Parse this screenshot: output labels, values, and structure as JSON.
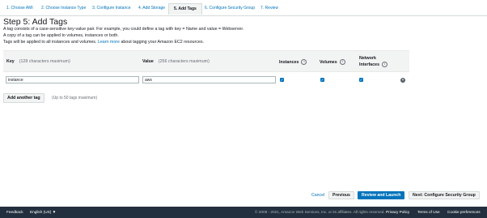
{
  "wizard": {
    "tabs": [
      {
        "label": "1. Choose AMI"
      },
      {
        "label": "2. Choose Instance Type"
      },
      {
        "label": "3. Configure Instance"
      },
      {
        "label": "4. Add Storage"
      },
      {
        "label": "5. Add Tags"
      },
      {
        "label": "6. Configure Security Group"
      },
      {
        "label": "7. Review"
      }
    ],
    "active_tab": "5. Add Tags"
  },
  "page": {
    "title": "Step 5: Add Tags",
    "desc_line1": "A tag consists of a case-sensitive key-value pair. For example, you could define a tag with key = Name and value = Webserver.",
    "desc_line2": "A copy of a tag can be applied to volumes, instances or both.",
    "desc_line3_prefix": "Tags will be applied to all instances and volumes.",
    "learn_more": "Learn more",
    "desc_line3_suffix": "about tagging your Amazon EC2 resources."
  },
  "table": {
    "headers": {
      "key": "Key",
      "key_hint": "(128 characters maximum)",
      "value": "Value",
      "value_hint": "(256 characters maximum)",
      "instances": "Instances",
      "volumes": "Volumes",
      "network_line1": "Network",
      "network_line2": "Interfaces",
      "info": "i"
    },
    "rows": [
      {
        "key": "instance",
        "value": "aws",
        "instances": true,
        "volumes": true,
        "network_interfaces": true
      }
    ],
    "check_mark": "✓",
    "remove_mark": "✕"
  },
  "add_tag": {
    "button": "Add another tag",
    "hint": "(Up to 50 tags maximum)"
  },
  "actions": {
    "cancel": "Cancel",
    "previous": "Previous",
    "review_launch": "Review and Launch",
    "next": "Next: Configure Security Group"
  },
  "footer": {
    "feedback": "Feedback",
    "language": "English (US) ▼",
    "copyright": "© 2008 - 2021, Amazon Web Services, Inc. or its affiliates. All rights reserved.",
    "privacy": "Privacy Policy",
    "terms": "Terms of Use",
    "cookies": "Cookie preferences"
  },
  "colors": {
    "accent": "#0073bb",
    "primary_button": "#0073bb",
    "footer_bg": "#232f3e",
    "table_header_bg": "#f2f3f3"
  }
}
